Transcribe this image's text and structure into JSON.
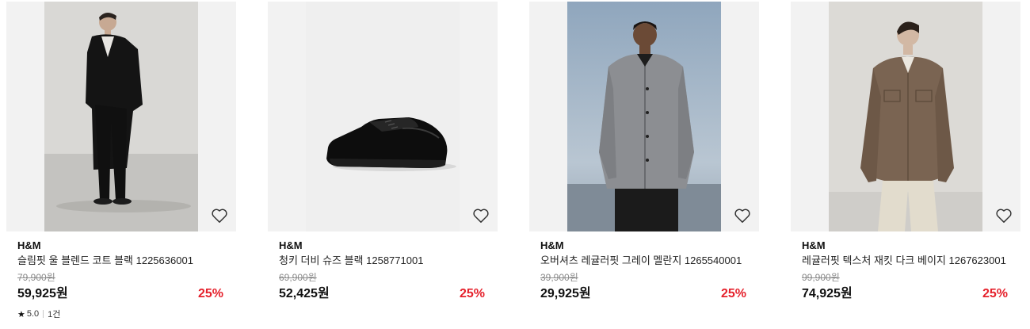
{
  "products": [
    {
      "brand": "H&M",
      "name": "슬림핏 울 블렌드 코트 블랙 1225636001",
      "original_price": "79,900원",
      "price": "59,925원",
      "discount": "25%",
      "rating": "5.0",
      "review_count": "1건",
      "image": "model-black-coat"
    },
    {
      "brand": "H&M",
      "name": "청키 더비 슈즈 블랙 1258771001",
      "original_price": "69,900원",
      "price": "52,425원",
      "discount": "25%",
      "image": "black-derby-shoe"
    },
    {
      "brand": "H&M",
      "name": "오버셔츠 레귤러핏 그레이 멜란지 1265540001",
      "original_price": "39,900원",
      "price": "29,925원",
      "discount": "25%",
      "image": "model-grey-overshirt"
    },
    {
      "brand": "H&M",
      "name": "레귤러핏 텍스처 재킷 다크 베이지 1267623001",
      "original_price": "99,900원",
      "price": "74,925원",
      "discount": "25%",
      "image": "model-beige-jacket"
    }
  ],
  "icons": {
    "wishlist": "heart-outline-icon",
    "rating": "star-icon"
  },
  "colors": {
    "discount": "#e5212c",
    "original_price": "#8a8a8a",
    "thumb_bg": "#f2f2f2"
  }
}
